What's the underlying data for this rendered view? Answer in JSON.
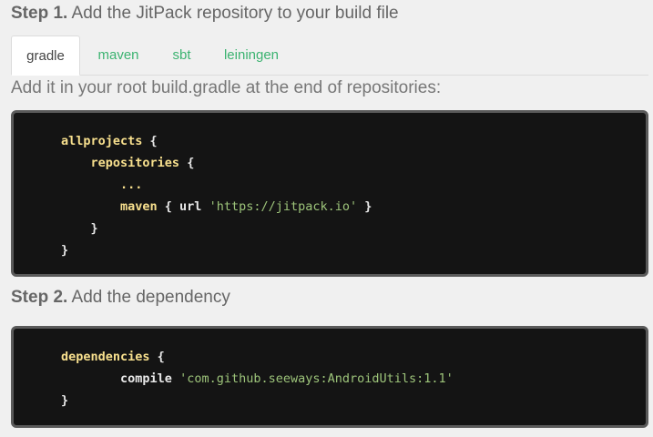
{
  "step1": {
    "label": "Step 1.",
    "text": " Add the JitPack repository to your build file"
  },
  "tabs": [
    {
      "label": "gradle",
      "active": true
    },
    {
      "label": "maven",
      "active": false
    },
    {
      "label": "sbt",
      "active": false
    },
    {
      "label": "leiningen",
      "active": false
    }
  ],
  "instruction": "Add it in your root build.gradle at the end of repositories:",
  "code1": {
    "lines": [
      {
        "indent": "",
        "kw": "allprojects",
        "rest": " {",
        "str": "",
        "end": ""
      },
      {
        "indent": "    ",
        "kw": "repositories",
        "rest": " {",
        "str": "",
        "end": ""
      },
      {
        "indent": "        ",
        "kw": "...",
        "rest": "",
        "str": "",
        "end": ""
      },
      {
        "indent": "        ",
        "kw": "maven",
        "rest": " { url ",
        "str": "'https://jitpack.io'",
        "end": " }"
      },
      {
        "indent": "    ",
        "kw": "",
        "rest": "}",
        "str": "",
        "end": ""
      },
      {
        "indent": "",
        "kw": "",
        "rest": "}",
        "str": "",
        "end": ""
      }
    ]
  },
  "step2": {
    "label": "Step 2.",
    "text": " Add the dependency"
  },
  "code2": {
    "lines": [
      {
        "indent": "",
        "kw": "dependencies",
        "rest": " {",
        "str": "",
        "end": ""
      },
      {
        "indent": "        ",
        "kw": "",
        "rest": "compile ",
        "str": "'com.github.seeways:AndroidUtils:1.1'",
        "end": ""
      },
      {
        "indent": "",
        "kw": "",
        "rest": "}",
        "str": "",
        "end": ""
      }
    ]
  },
  "colors": {
    "accent": "#3cb371",
    "code_background": "#141414",
    "code_keyword": "#f8e08e",
    "code_string": "#9dc47a"
  }
}
